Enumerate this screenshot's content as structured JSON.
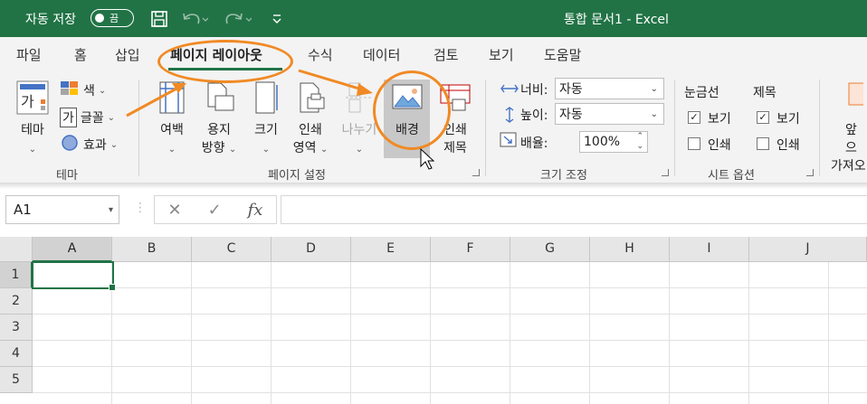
{
  "titlebar": {
    "autosave_label": "자동 저장",
    "autosave_state": "끔",
    "doc_title": "통합 문서1  -  Excel"
  },
  "tabs": [
    "파일",
    "홈",
    "삽입",
    "페이지 레이아웃",
    "수식",
    "데이터",
    "검토",
    "보기",
    "도움말"
  ],
  "active_tab": "페이지 레이아웃",
  "ribbon": {
    "theme": {
      "themes_label": "테마",
      "colors_label": "색",
      "fonts_label": "글꼴",
      "effects_label": "효과",
      "group_label": "테마"
    },
    "page_setup": {
      "margins_label": "여백",
      "orientation_label_1": "용지",
      "orientation_label_2": "방향",
      "size_label": "크기",
      "print_area_label_1": "인쇄",
      "print_area_label_2": "영역",
      "breaks_label": "나누기",
      "background_label": "배경",
      "print_titles_label_1": "인쇄",
      "print_titles_label_2": "제목",
      "group_label": "페이지 설정"
    },
    "scale_to_fit": {
      "width_label": "너비:",
      "width_value": "자동",
      "height_label": "높이:",
      "height_value": "자동",
      "scale_label": "배율:",
      "scale_value": "100%",
      "group_label": "크기 조정"
    },
    "sheet_options": {
      "gridlines_label": "눈금선",
      "headings_label": "제목",
      "view_label": "보기",
      "print_label": "인쇄",
      "gridlines_view": true,
      "gridlines_print": false,
      "headings_view": true,
      "headings_print": false,
      "group_label": "시트 옵션"
    },
    "arrange": {
      "bring_forward_1": "앞으",
      "bring_forward_2": "가져오"
    }
  },
  "formula_bar": {
    "name_box": "A1",
    "cancel_icon": "close-icon",
    "enter_icon": "check-icon",
    "fx_label": "fx",
    "formula": ""
  },
  "grid": {
    "columns": [
      "A",
      "B",
      "C",
      "D",
      "E",
      "F",
      "G",
      "H",
      "I",
      "J"
    ],
    "rows": [
      "1",
      "2",
      "3",
      "4",
      "5"
    ],
    "selected_cell": "A1"
  },
  "colors": {
    "excel_green": "#217346",
    "annotation_orange": "#f08a24"
  }
}
